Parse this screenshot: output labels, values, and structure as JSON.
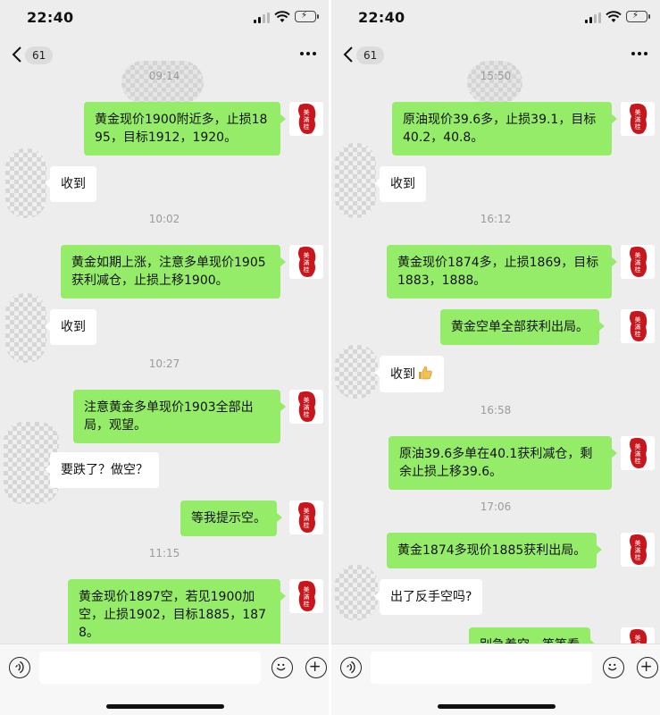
{
  "left": {
    "status_time": "22:40",
    "back_badge": "61",
    "timestamps": [
      "09:14",
      "10:02",
      "10:27",
      "11:15"
    ],
    "messages": [
      {
        "dir": "out",
        "text": "黄金现价1900附近多，止损1895，目标1912，1920。"
      },
      {
        "dir": "in",
        "text": "收到"
      },
      {
        "dir": "out",
        "text": "黄金如期上涨，注意多单现价1905获利减仓，止损上移1900。"
      },
      {
        "dir": "in",
        "text": "收到"
      },
      {
        "dir": "out",
        "text": "注意黄金多单现价1903全部出局，观望。"
      },
      {
        "dir": "in",
        "text": "要跌了？做空？"
      },
      {
        "dir": "out",
        "text": "等我提示空。"
      },
      {
        "dir": "out",
        "text": "黄金现价1897空，若见1900加空，止损1902，目标1885，1878。"
      }
    ]
  },
  "right": {
    "status_time": "22:40",
    "back_badge": "61",
    "timestamps": [
      "15:50",
      "16:12",
      "16:58",
      "17:06"
    ],
    "messages": [
      {
        "dir": "out",
        "text": "原油现价39.6多，止损39.1，目标40.2，40.8。"
      },
      {
        "dir": "in",
        "text": "收到"
      },
      {
        "dir": "out",
        "text": "黄金现价1874多，止损1869，目标1883，1888。"
      },
      {
        "dir": "out",
        "text": "黄金空单全部获利出局。"
      },
      {
        "dir": "in",
        "text": "收到",
        "emoji": "thumbs-up-icon"
      },
      {
        "dir": "out",
        "text": "原油39.6多单在40.1获利减仓，剩余止损上移39.6。"
      },
      {
        "dir": "out",
        "text": "黄金1874多现价1885获利出局。"
      },
      {
        "dir": "in",
        "text": "出了反手空吗?"
      },
      {
        "dir": "out",
        "text": "别急着空，等等看"
      }
    ]
  },
  "colors": {
    "chat_bg": "#ededed",
    "outgoing_bubble": "#95ec69",
    "incoming_bubble": "#ffffff",
    "timestamp": "#9b9b9b",
    "seal_red": "#c8161d"
  },
  "icons": [
    "back-chevron-icon",
    "more-icon",
    "voice-icon",
    "emoji-icon",
    "plus-icon",
    "signal-icon",
    "wifi-icon",
    "battery-icon",
    "seal-avatar"
  ]
}
